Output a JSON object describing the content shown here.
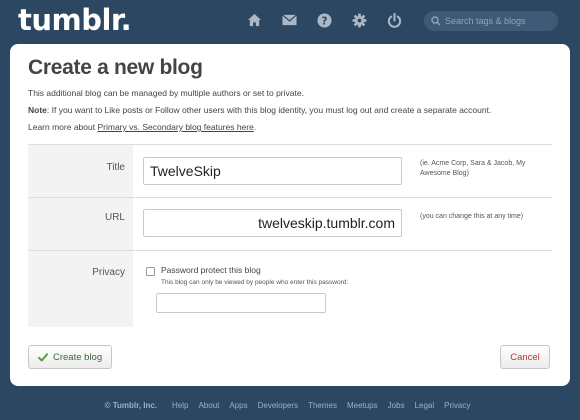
{
  "header": {
    "logo": "tumblr.",
    "nav_icons": [
      "home-icon",
      "mail-icon",
      "help-icon",
      "gear-icon",
      "power-icon"
    ],
    "search": {
      "placeholder": "Search tags & blogs",
      "value": "",
      "icon": "search-icon"
    }
  },
  "page": {
    "title": "Create a new blog",
    "intro": "This additional blog can be managed by multiple authors or set to private.",
    "note_label": "Note",
    "note_text": ": If you want to Like posts or Follow other users with this blog identity, you must log out and create a separate account.",
    "learn_prefix": "Learn more about ",
    "learn_link": "Primary vs. Secondary blog features here",
    "learn_suffix": "."
  },
  "form": {
    "title": {
      "label": "Title",
      "value": "TwelveSkip",
      "hint": "(ie. Acme Corp, Sara & Jacob, My Awesome Blog)"
    },
    "url": {
      "label": "URL",
      "value": "twelveskip.tumblr.com",
      "hint": "(you can change this at any time)"
    },
    "privacy": {
      "label": "Privacy",
      "checkbox_label": "Password protect this blog",
      "checked": false,
      "sub_hint": "This blog can only be viewed by people who enter this password:",
      "password_value": ""
    }
  },
  "buttons": {
    "create": "Create blog",
    "cancel": "Cancel"
  },
  "footer": {
    "copyright": "© Tumblr, Inc.",
    "links": [
      "Help",
      "About",
      "Apps",
      "Developers",
      "Themes",
      "Meetups",
      "Jobs",
      "Legal",
      "Privacy"
    ]
  },
  "colors": {
    "background": "#2c4762",
    "create_text": "#3a6b3a",
    "check_icon": "#5b9a47",
    "cancel_text": "#c0392b"
  }
}
